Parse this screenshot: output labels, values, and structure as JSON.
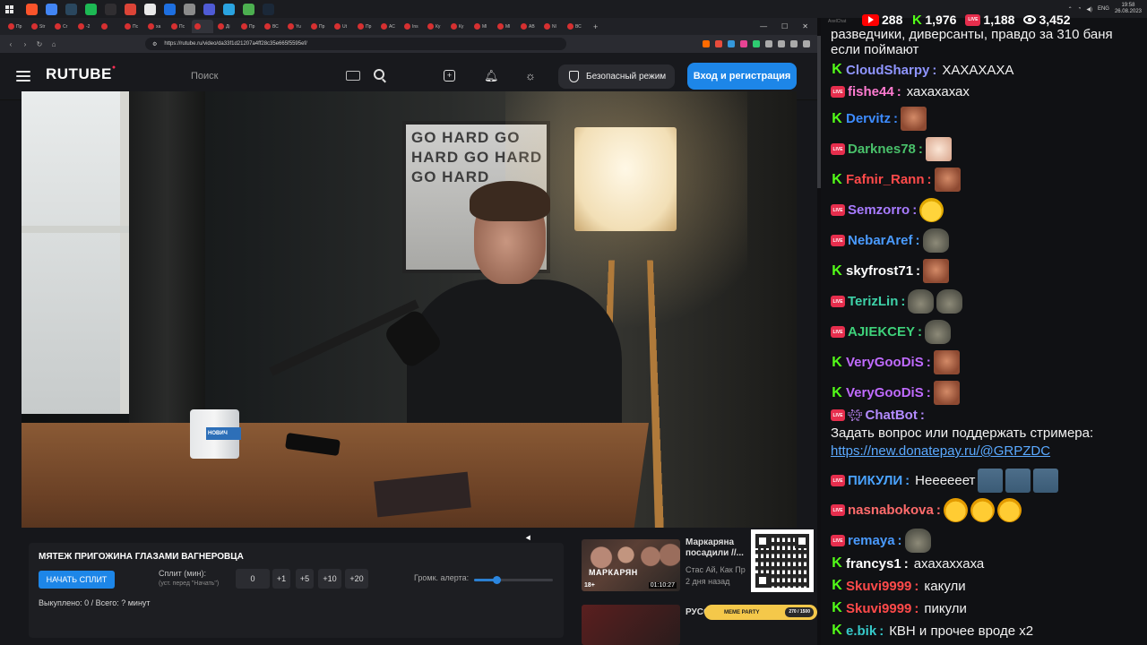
{
  "os": {
    "tray_lang": "ENG",
    "clock_time": "19:58",
    "clock_date": "26.08.2023",
    "taskbar_apps": [
      {
        "name": "brave",
        "color": "#fb542b"
      },
      {
        "name": "chrome",
        "color": "#4285f4"
      },
      {
        "name": "steam",
        "color": "#2a475e"
      },
      {
        "name": "spotify",
        "color": "#1db954"
      },
      {
        "name": "obs",
        "color": "#302e31"
      },
      {
        "name": "chrome-2",
        "color": "#db4437"
      },
      {
        "name": "capcut",
        "color": "#e8e8e8"
      },
      {
        "name": "app-blue",
        "color": "#1e6fe0"
      },
      {
        "name": "files",
        "color": "#8b8b8b"
      },
      {
        "name": "app-indigo",
        "color": "#4f5bd5"
      },
      {
        "name": "telegram",
        "color": "#2aa3e0"
      },
      {
        "name": "app-green",
        "color": "#4caf50"
      },
      {
        "name": "steam-2",
        "color": "#1b2838"
      }
    ]
  },
  "browser": {
    "tabs": [
      "Пр",
      "Str",
      "Cr",
      "-2",
      "",
      "Пс",
      "ха",
      "Пс",
      "",
      "Дi",
      "Пр",
      "ВС",
      "Yu",
      "Пр",
      "Ut",
      "Пр",
      "АС",
      "Ins",
      "Ку",
      "Ку",
      "Ml",
      "Ml",
      "АВ",
      "Nl",
      "ВС"
    ],
    "active_tab": 8,
    "url": "https://rutube.ru/video/da33f1d21207a4ff28c35e665f5595ef/",
    "extension_colors": [
      "#ff6b00",
      "#e74c3c",
      "#3498db",
      "#e84393",
      "#2ecc71",
      "#aaaaaa",
      "#aaaaaa",
      "#aaaaaa",
      "#aaaaaa"
    ]
  },
  "rutube": {
    "logo": "RUTUBE",
    "search_placeholder": "Поиск",
    "safe_mode": "Безопасный режим",
    "login": "Вход и регистрация",
    "mug_text": "НОВИЧ",
    "poster_text": "GO HARD GO HARD GO HARD GO HARD"
  },
  "split": {
    "title": "МЯТЕЖ ПРИГОЖИНА ГЛАЗАМИ ВАГНЕРОВЦА",
    "start_label": "НАЧАТЬ СПЛИТ",
    "minutes_label": "Сплит (мин):",
    "minutes_hint": "(уст. перед \"Начать\")",
    "minutes_value": "0",
    "steps": [
      "+1",
      "+5",
      "+10",
      "+20"
    ],
    "volume_label": "Громк. алерта:",
    "volume": 0.28,
    "stats": "Выкуплено: 0 / Всего: ? минут"
  },
  "recs": [
    {
      "title": "Маркаряна посадили //...",
      "thumb_text": "МАРКАРЯН",
      "badge": "18+",
      "duration": "01:10:27",
      "author": "Стас Ай, Как Пр",
      "date": "2 дня назад"
    },
    {
      "title": "РУССК БОЛ"
    }
  ],
  "donate": {
    "label": "MEME PARTY",
    "value": "270 / 1500"
  },
  "chat": {
    "window_label": "AxelChat",
    "stats": {
      "youtube": "288",
      "kick": "1,976",
      "live": "1,188",
      "viewers": "3,452"
    },
    "top_text": "разведчики, диверсанты, правдо за 310 баня если поймают",
    "messages": [
      {
        "platform": "kick",
        "user": "CloudSharpy",
        "color": "#8f95ff",
        "text": "ХАХАХАХА",
        "emotes": []
      },
      {
        "platform": "live",
        "user": "fishe44",
        "color": "#ff7bd0",
        "text": "хахахахах",
        "emotes": []
      },
      {
        "platform": "kick",
        "user": "Dervitz",
        "color": "#3d8cff",
        "text": "",
        "emotes": [
          "face"
        ]
      },
      {
        "platform": "live",
        "user": "Darknes78",
        "color": "#49c06a",
        "text": "",
        "emotes": [
          "blur"
        ]
      },
      {
        "platform": "kick",
        "user": "Fafnir_Rann",
        "color": "#ff4a4a",
        "text": "",
        "emotes": [
          "face"
        ]
      },
      {
        "platform": "live",
        "user": "Semzorro",
        "color": "#a87bff",
        "text": "",
        "emotes": [
          "laugh"
        ]
      },
      {
        "platform": "live",
        "user": "NebarAref",
        "color": "#4a9bff",
        "text": "",
        "emotes": [
          "frog"
        ]
      },
      {
        "platform": "kick",
        "user": "skyfrost71",
        "color": "#ffffff",
        "text": "",
        "emotes": [
          "face"
        ]
      },
      {
        "platform": "live",
        "user": "TerizLin",
        "color": "#3ed1a8",
        "text": "",
        "emotes": [
          "frog",
          "frog"
        ]
      },
      {
        "platform": "live",
        "user": "AJIEKCEY",
        "color": "#3ed17a",
        "text": "",
        "emotes": [
          "frog"
        ]
      },
      {
        "platform": "kick",
        "user": "VeryGooDiS",
        "color": "#c06bff",
        "text": "",
        "emotes": [
          "face"
        ]
      },
      {
        "platform": "kick",
        "user": "VeryGooDiS",
        "color": "#c06bff",
        "text": "",
        "emotes": [
          "face"
        ]
      },
      {
        "platform": "live",
        "user": "ПИКУЛИ",
        "color": "#4aa3ff",
        "text": "Неееееет",
        "emotes": [
          "fish",
          "fish",
          "fish"
        ]
      },
      {
        "platform": "live",
        "user": "nasnabokova",
        "color": "#ff6b6b",
        "text": "",
        "emotes": [
          "cry",
          "cry",
          "cry"
        ]
      },
      {
        "platform": "live",
        "user": "remaya",
        "color": "#4a9bff",
        "text": "",
        "emotes": [
          "frog"
        ]
      },
      {
        "platform": "kick",
        "user": "francys1",
        "color": "#ffffff",
        "text": "ахахаххаха",
        "emotes": []
      },
      {
        "platform": "kick",
        "user": "Skuvi9999",
        "color": "#ff4a4a",
        "text": "какули",
        "emotes": []
      },
      {
        "platform": "kick",
        "user": "Skuvi9999",
        "color": "#ff4a4a",
        "text": "пикули",
        "emotes": []
      },
      {
        "platform": "kick",
        "user": "e.bik",
        "color": "#36c9c9",
        "text": "КВН и прочее вроде x2",
        "emotes": []
      }
    ],
    "chatbot": {
      "user": "ChatBot",
      "color": "#b38bff",
      "text": "Задать вопрос или поддержать стримера:",
      "link": "https://new.donatepay.ru/@GRPZDC"
    }
  }
}
